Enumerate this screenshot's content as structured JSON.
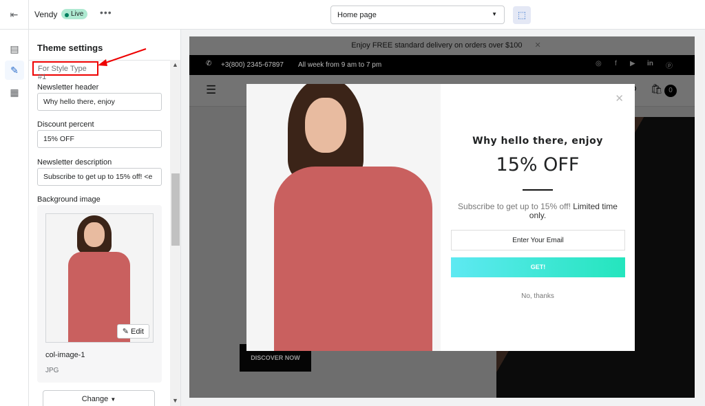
{
  "topbar": {
    "store_name": "Vendy",
    "status": "Live",
    "more": "•••",
    "page_select": "Home page"
  },
  "panel": {
    "title": "Theme settings",
    "style_type": "For Style Type #1",
    "fields": [
      {
        "label": "Newsletter header",
        "value": "Why hello there, enjoy"
      },
      {
        "label": "Discount percent",
        "value": "15% OFF"
      },
      {
        "label": "Newsletter description",
        "value": "Subscribe to get up to 15% off! <e"
      }
    ],
    "bg_image": {
      "label": "Background image",
      "edit": "Edit",
      "file_name": "col-image-1",
      "file_type": "JPG",
      "change": "Change"
    }
  },
  "site": {
    "announcement": "Enjoy FREE standard delivery on orders over $100",
    "phone": "+3(800) 2345-67897",
    "hours": "All week from 9 am to 7 pm",
    "cart_count": "0",
    "hero_button": "DISCOVER NOW",
    "popup": {
      "header": "Why hello there, enjoy",
      "discount": "15% OFF",
      "desc_main": "Subscribe to get up to 15% off!",
      "desc_bold": "Limited time only.",
      "email_placeholder": "Enter Your Email",
      "button": "GET!",
      "decline": "No, thanks"
    }
  },
  "colors": {
    "accent": "#2c6ecb",
    "live_badge": "#aee9d1",
    "annotation": "#ee0000",
    "button_start": "#5ee9f2",
    "button_end": "#24e5bd",
    "dress": "#c9605f"
  }
}
